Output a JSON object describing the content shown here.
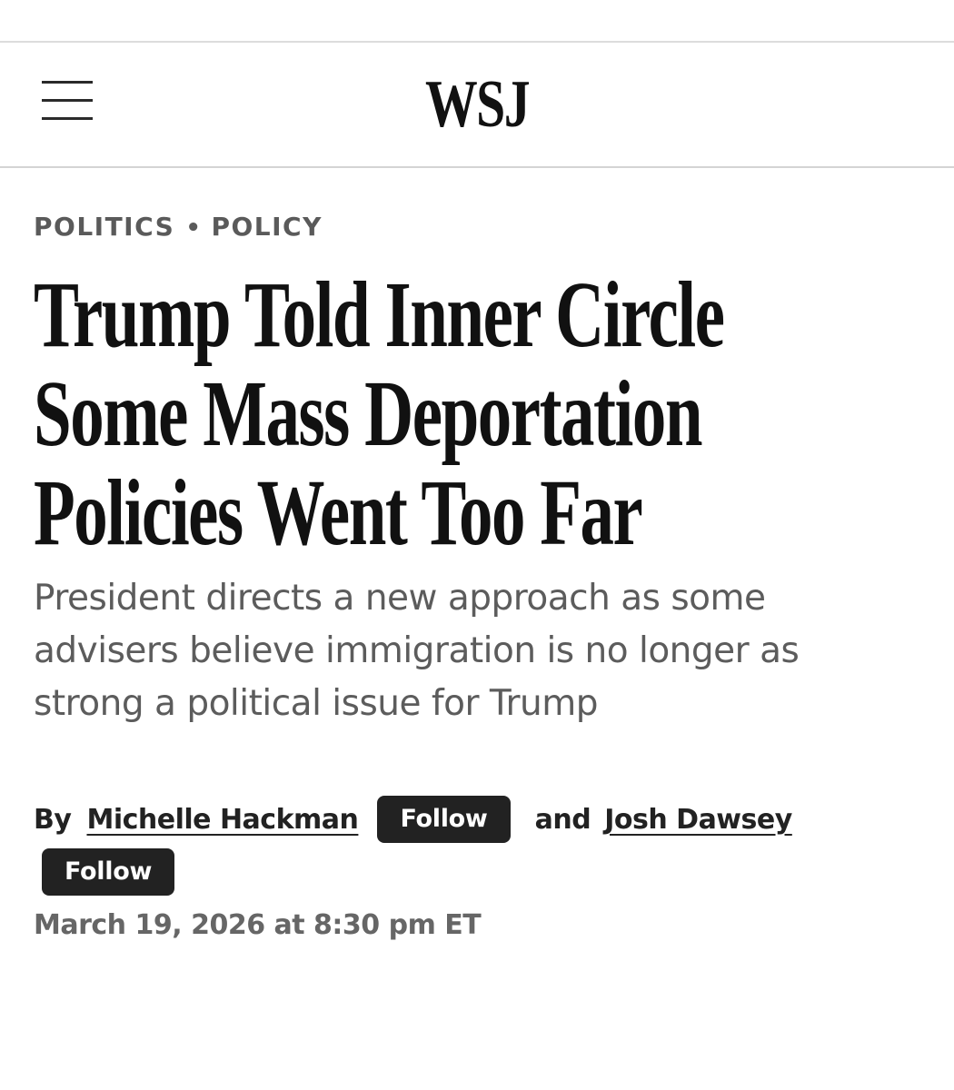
{
  "header": {
    "logo": "WSJ",
    "menu_icon": "hamburger-menu-icon"
  },
  "breadcrumb": {
    "section": "POLITICS",
    "separator": "•",
    "subsection": "POLICY"
  },
  "article": {
    "headline_lines": [
      "Trump Told Inner Circle",
      "Some Mass Deportation",
      "Policies Went Too Far"
    ],
    "dek_lines": [
      "President directs a new approach as some",
      "advisers believe immigration is no longer as",
      "strong a political issue for Trump"
    ],
    "byline": {
      "by_label": "By",
      "authors": [
        {
          "name": "Michelle Hackman",
          "follow_label": "Follow"
        },
        {
          "name": "Josh Dawsey",
          "follow_label": "Follow"
        }
      ],
      "conjunction": "and"
    },
    "timestamp": "March 19, 2026 at 8:30 pm ET"
  },
  "colors": {
    "background": "#ffffff",
    "text": "#111111",
    "muted_text": "#5c5c5c",
    "button_bg": "#222222",
    "button_text": "#ffffff",
    "rule": "#d4d4d4"
  }
}
